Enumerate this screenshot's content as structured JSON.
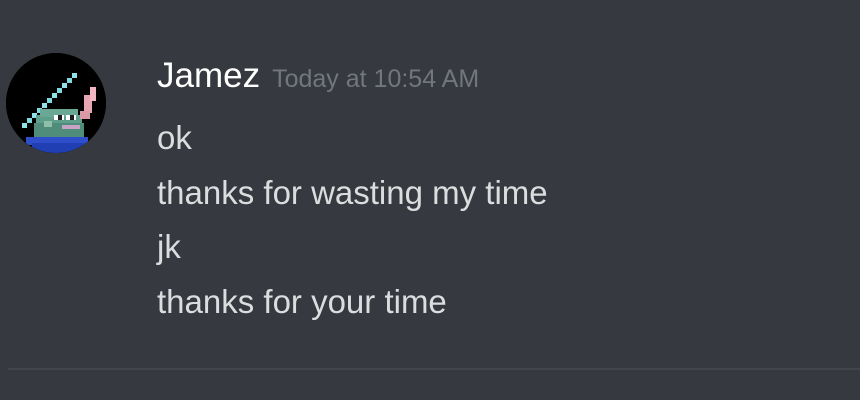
{
  "message_group": {
    "author": {
      "name": "Jamez",
      "avatar_icon": "pixel-frog-avatar-icon"
    },
    "timestamp": "Today at 10:54 AM",
    "messages": [
      "ok",
      "thanks for wasting my time",
      "jk",
      "thanks for your time"
    ]
  },
  "colors": {
    "background": "#36393f",
    "username": "#ffffff",
    "timestamp": "#72767d",
    "message_text": "#dcddde",
    "divider": "#42454a"
  }
}
